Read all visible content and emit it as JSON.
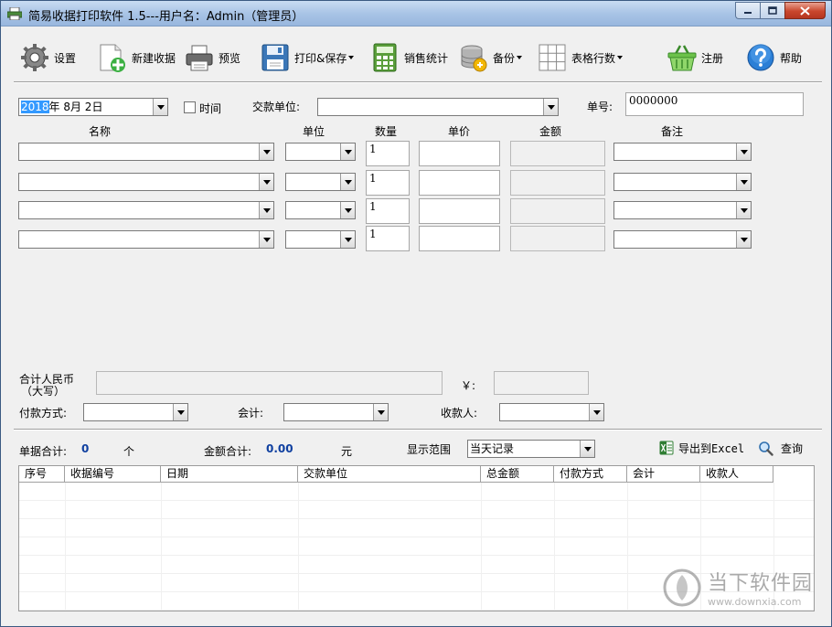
{
  "window": {
    "title": "简易收据打印软件 1.5---用户名：Admin（管理员）",
    "controls": [
      "minimize",
      "maximize",
      "close"
    ]
  },
  "toolbar": {
    "settings": "设置",
    "new_receipt": "新建收据",
    "preview": "预览",
    "print_save": "打印&保存",
    "sales_stats": "销售统计",
    "backup": "备份",
    "table_rows": "表格行数",
    "register": "注册",
    "help": "帮助"
  },
  "header": {
    "date_year_selected": "2018",
    "date_rest": "年  8月  2日",
    "time_label": "时间",
    "party_label": "交款单位:",
    "party_value": "",
    "order_no_label": "单号:",
    "order_no_value": "0000000"
  },
  "items": {
    "columns": {
      "name": "名称",
      "unit": "单位",
      "qty": "数量",
      "price": "单价",
      "amount": "金额",
      "note": "备注"
    },
    "rows": [
      {
        "qty": "1"
      },
      {
        "qty": "1"
      },
      {
        "qty": "1"
      },
      {
        "qty": "1"
      }
    ]
  },
  "totals": {
    "rmb_label_1": "合计人民币",
    "rmb_label_2": "（大写）",
    "yen_label": "￥:",
    "pay_method_label": "付款方式:",
    "accountant_label": "会计:",
    "payee_label": "收款人:"
  },
  "summary": {
    "count_label": "单据合计:",
    "count_value": "0",
    "count_unit": "个",
    "amount_label": "金额合计:",
    "amount_value": "0.00",
    "amount_unit": "元",
    "range_label": "显示范围",
    "range_value": "当天记录",
    "export_label": "导出到Excel",
    "query_label": "查询"
  },
  "records": {
    "columns": [
      "序号",
      "收据编号",
      "日期",
      "交款单位",
      "总金额",
      "付款方式",
      "会计",
      "收款人"
    ],
    "rows": []
  },
  "watermark": {
    "site_name": "当下软件园",
    "url": "www.downxia.com"
  }
}
